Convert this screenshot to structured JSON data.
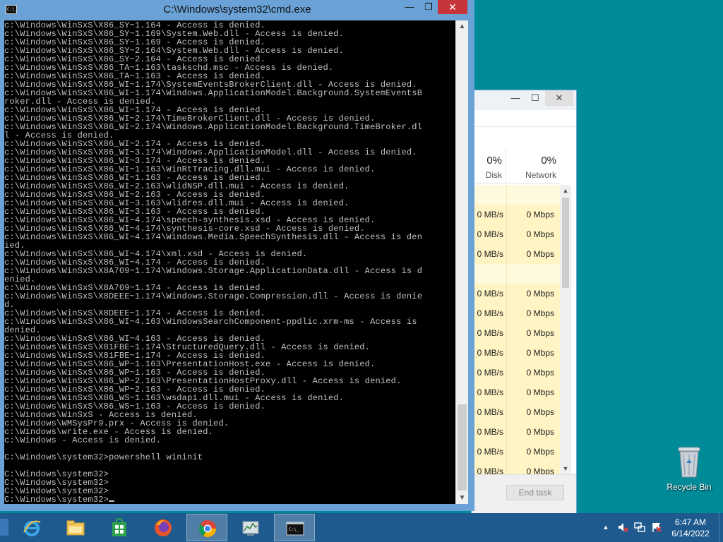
{
  "desktop": {
    "background": "#008b99"
  },
  "task_manager": {
    "columns": [
      {
        "percent": "0%",
        "label": "Disk"
      },
      {
        "percent": "0%",
        "label": "Network"
      }
    ],
    "rows": [
      {
        "disk": "",
        "network": "",
        "group": true
      },
      {
        "disk": "0 MB/s",
        "network": "0 Mbps"
      },
      {
        "disk": "0 MB/s",
        "network": "0 Mbps"
      },
      {
        "disk": "0 MB/s",
        "network": "0 Mbps"
      },
      {
        "disk": "",
        "network": "",
        "group": true
      },
      {
        "disk": "0 MB/s",
        "network": "0 Mbps"
      },
      {
        "disk": "0 MB/s",
        "network": "0 Mbps"
      },
      {
        "disk": "0 MB/s",
        "network": "0 Mbps"
      },
      {
        "disk": "0 MB/s",
        "network": "0 Mbps"
      },
      {
        "disk": "0 MB/s",
        "network": "0 Mbps"
      },
      {
        "disk": "0 MB/s",
        "network": "0 Mbps"
      },
      {
        "disk": "0 MB/s",
        "network": "0 Mbps"
      },
      {
        "disk": "0 MB/s",
        "network": "0 Mbps"
      },
      {
        "disk": "0 MB/s",
        "network": "0 Mbps"
      },
      {
        "disk": "0 MB/s",
        "network": "0 Mbps"
      }
    ],
    "end_task_label": "End task",
    "close_glyph": "✕",
    "maximize_glyph": "☐",
    "minimize_glyph": "—"
  },
  "cmd": {
    "title": "C:\\Windows\\system32\\cmd.exe",
    "icon_text": "C:\\_",
    "minimize_glyph": "—",
    "maximize_glyph": "❐",
    "close_glyph": "✕",
    "lines": [
      "c:\\Windows\\WinSxS\\X86_SY~1.164 - Access is denied.",
      "c:\\Windows\\WinSxS\\X86_SY~1.169\\System.Web.dll - Access is denied.",
      "c:\\Windows\\WinSxS\\X86_SY~1.169 - Access is denied.",
      "c:\\Windows\\WinSxS\\X86_SY~2.164\\System.Web.dll - Access is denied.",
      "c:\\Windows\\WinSxS\\X86_SY~2.164 - Access is denied.",
      "c:\\Windows\\WinSxS\\X86_TA~1.163\\taskschd.msc - Access is denied.",
      "c:\\Windows\\WinSxS\\X86_TA~1.163 - Access is denied.",
      "c:\\Windows\\WinSxS\\X86_WI~1.174\\SystemEventsBrokerClient.dll - Access is denied.",
      "c:\\Windows\\WinSxS\\X86_WI~1.174\\Windows.ApplicationModel.Background.SystemEventsB",
      "roker.dll - Access is denied.",
      "c:\\Windows\\WinSxS\\X86_WI~1.174 - Access is denied.",
      "c:\\Windows\\WinSxS\\X86_WI~2.174\\TimeBrokerClient.dll - Access is denied.",
      "c:\\Windows\\WinSxS\\X86_WI~2.174\\Windows.ApplicationModel.Background.TimeBroker.dl",
      "l - Access is denied.",
      "c:\\Windows\\WinSxS\\X86_WI~2.174 - Access is denied.",
      "c:\\Windows\\WinSxS\\X86_WI~3.174\\Windows.ApplicationModel.dll - Access is denied.",
      "c:\\Windows\\WinSxS\\X86_WI~3.174 - Access is denied.",
      "c:\\Windows\\WinSxS\\X86_WI~1.163\\WinRtTracing.dll.mui - Access is denied.",
      "c:\\Windows\\WinSxS\\X86_WI~1.163 - Access is denied.",
      "c:\\Windows\\WinSxS\\X86_WI~2.163\\wlidNSP.dll.mui - Access is denied.",
      "c:\\Windows\\WinSxS\\X86_WI~2.163 - Access is denied.",
      "c:\\Windows\\WinSxS\\X86_WI~3.163\\wlidres.dll.mui - Access is denied.",
      "c:\\Windows\\WinSxS\\X86_WI~3.163 - Access is denied.",
      "c:\\Windows\\WinSxS\\X86_WI~4.174\\speech-synthesis.xsd - Access is denied.",
      "c:\\Windows\\WinSxS\\X86_WI~4.174\\synthesis-core.xsd - Access is denied.",
      "c:\\Windows\\WinSxS\\X86_WI~4.174\\Windows.Media.SpeechSynthesis.dll - Access is den",
      "ied.",
      "c:\\Windows\\WinSxS\\X86_WI~4.174\\xml.xsd - Access is denied.",
      "c:\\Windows\\WinSxS\\X86_WI~4.174 - Access is denied.",
      "c:\\Windows\\WinSxS\\X8A709~1.174\\Windows.Storage.ApplicationData.dll - Access is d",
      "enied.",
      "c:\\Windows\\WinSxS\\X8A709~1.174 - Access is denied.",
      "c:\\Windows\\WinSxS\\X8DEEE~1.174\\Windows.Storage.Compression.dll - Access is denie",
      "d.",
      "c:\\Windows\\WinSxS\\X8DEEE~1.174 - Access is denied.",
      "c:\\Windows\\WinSxS\\X86_WI~4.163\\WindowsSearchComponent-ppdlic.xrm-ms - Access is",
      "denied.",
      "c:\\Windows\\WinSxS\\X86_WI~4.163 - Access is denied.",
      "c:\\Windows\\WinSxS\\X81FBE~1.174\\StructuredQuery.dll - Access is denied.",
      "c:\\Windows\\WinSxS\\X81FBE~1.174 - Access is denied.",
      "c:\\Windows\\WinSxS\\X86_WP~1.163\\PresentationHost.exe - Access is denied.",
      "c:\\Windows\\WinSxS\\X86_WP~1.163 - Access is denied.",
      "c:\\Windows\\WinSxS\\X86_WP~2.163\\PresentationHostProxy.dll - Access is denied.",
      "c:\\Windows\\WinSxS\\X86_WP~2.163 - Access is denied.",
      "c:\\Windows\\WinSxS\\X86_WS~1.163\\wsdapi.dll.mui - Access is denied.",
      "c:\\Windows\\WinSxS\\X86_WS~1.163 - Access is denied.",
      "c:\\Windows\\WinSxS - Access is denied.",
      "c:\\Windows\\WMSysPr9.prx - Access is denied.",
      "c:\\Windows\\write.exe - Access is denied.",
      "c:\\Windows - Access is denied.",
      "",
      "C:\\Windows\\system32>powershell wininit",
      "",
      "C:\\Windows\\system32>",
      "C:\\Windows\\system32>",
      "C:\\Windows\\system32>",
      "C:\\Windows\\system32>"
    ],
    "scroll_up_glyph": "▲",
    "scroll_down_glyph": "▼"
  },
  "recycle_bin": {
    "label": "Recycle Bin"
  },
  "taskbar": {
    "apps": [
      {
        "name": "internet-explorer",
        "active": false
      },
      {
        "name": "file-explorer",
        "active": false
      },
      {
        "name": "store",
        "active": false
      },
      {
        "name": "firefox",
        "active": false
      },
      {
        "name": "chrome",
        "active": true
      },
      {
        "name": "task-manager",
        "active": false
      },
      {
        "name": "command-prompt",
        "active": true
      }
    ],
    "tray": {
      "chevron_glyph": "▲",
      "time": "6:47 AM",
      "date": "6/14/2022"
    }
  }
}
